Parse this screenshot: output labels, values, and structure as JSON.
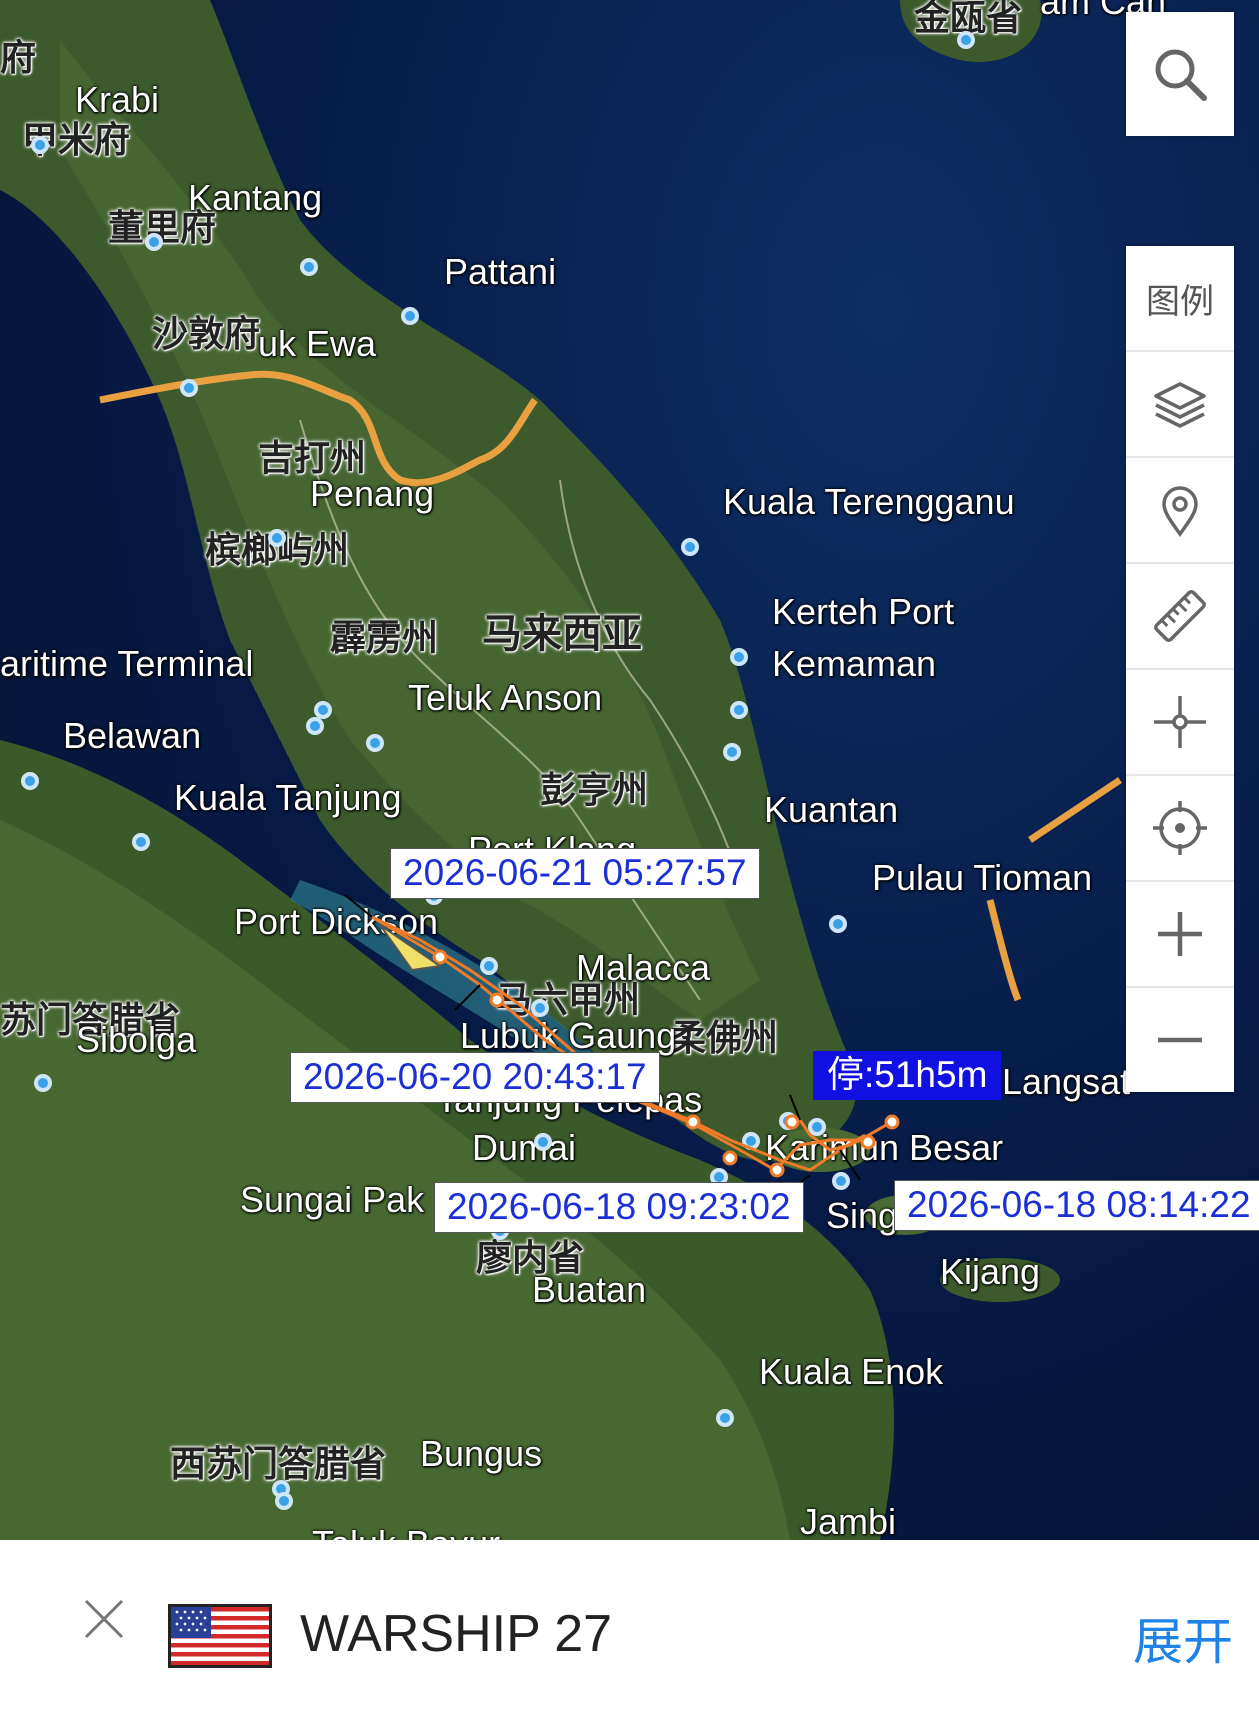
{
  "map": {
    "place_labels": [
      {
        "id": "krabi",
        "text": "Krabi"
      },
      {
        "id": "kantang",
        "text": "Kantang"
      },
      {
        "id": "pattani",
        "text": "Pattani"
      },
      {
        "id": "teluk-ewa",
        "text": "uk Ewa"
      },
      {
        "id": "penang",
        "text": "Penang"
      },
      {
        "id": "kuala-terengganu",
        "text": "Kuala Terengganu"
      },
      {
        "id": "kerteh-port",
        "text": "Kerteh Port"
      },
      {
        "id": "kemaman",
        "text": "Kemaman"
      },
      {
        "id": "maritime-terminal",
        "text": "aritime Terminal"
      },
      {
        "id": "teluk-anson",
        "text": "Teluk Anson"
      },
      {
        "id": "belawan",
        "text": "Belawan"
      },
      {
        "id": "kuala-tanjung",
        "text": "Kuala Tanjung"
      },
      {
        "id": "kuantan",
        "text": "Kuantan"
      },
      {
        "id": "port-klang",
        "text": "Port Klang"
      },
      {
        "id": "pulau-tioman",
        "text": "Pulau Tioman"
      },
      {
        "id": "port-dickson",
        "text": "Port Dickson"
      },
      {
        "id": "malacca",
        "text": "Malacca"
      },
      {
        "id": "sibolga",
        "text": "Sibolga"
      },
      {
        "id": "lubuk-gaung",
        "text": "Lubuk Gaung"
      },
      {
        "id": "tanjung-pelepas",
        "text": "Tanjung Pelepas"
      },
      {
        "id": "langsat",
        "text": "Langsat"
      },
      {
        "id": "dumai",
        "text": "Dumai"
      },
      {
        "id": "karimun-besar",
        "text": "Karimun Besar"
      },
      {
        "id": "sungai-pakning",
        "text": "Sungai Pak"
      },
      {
        "id": "singapore",
        "text": "Sing"
      },
      {
        "id": "kijang",
        "text": "Kijang"
      },
      {
        "id": "buatan",
        "text": "Buatan"
      },
      {
        "id": "kuala-enok",
        "text": "Kuala Enok"
      },
      {
        "id": "bungus",
        "text": "Bungus"
      },
      {
        "id": "jambi",
        "text": "Jambi"
      },
      {
        "id": "teluk-bayur",
        "text": "Teluk Bayur"
      },
      {
        "id": "top-edge",
        "text": "am Can"
      }
    ],
    "region_labels": [
      {
        "id": "top-left-fu",
        "text": "府"
      },
      {
        "id": "krabi-fu",
        "text": "甲米府"
      },
      {
        "id": "trang-fu",
        "text": "董里府"
      },
      {
        "id": "satun-fu",
        "text": "沙敦府"
      },
      {
        "id": "kedah",
        "text": "吉打州"
      },
      {
        "id": "penang-state",
        "text": "槟榔屿州"
      },
      {
        "id": "perak",
        "text": "霹雳州"
      },
      {
        "id": "malaysia",
        "text": "马来西亚"
      },
      {
        "id": "pahang",
        "text": "彭亨州"
      },
      {
        "id": "melaka",
        "text": "马六甲州"
      },
      {
        "id": "johor",
        "text": "柔佛州"
      },
      {
        "id": "north-sumatra",
        "text": "苏门答腊省"
      },
      {
        "id": "riau",
        "text": "廖内省"
      },
      {
        "id": "west-sumatra",
        "text": "西苏门答腊省"
      },
      {
        "id": "top-province",
        "text": "金瓯省"
      }
    ],
    "track_labels": [
      {
        "id": "ts-1",
        "text": "2026-06-21 05:27:57"
      },
      {
        "id": "ts-2",
        "text": "2026-06-20 20:43:17"
      },
      {
        "id": "ts-3",
        "text": "2026-06-18 09:23:02"
      },
      {
        "id": "ts-4",
        "text": "2026-06-18 08:14:22"
      }
    ],
    "stop_label": "停:51h5m",
    "colors": {
      "track": "#f07a28",
      "port": "#3aa0e8",
      "border": "#e8a040",
      "stop_bg": "#1010e0",
      "timestamp_text": "#1a2fd6"
    }
  },
  "toolbar": {
    "search_icon": "search-icon",
    "legend_label": "图例",
    "items": [
      "layers-icon",
      "location-pin-icon",
      "ruler-icon",
      "crosshair-icon",
      "locate-icon",
      "zoom-in-icon",
      "zoom-out-icon"
    ]
  },
  "vessel_bar": {
    "close_icon": "close-icon",
    "flag": "us-flag",
    "name": "WARSHIP 27",
    "expand_label": "展开"
  }
}
